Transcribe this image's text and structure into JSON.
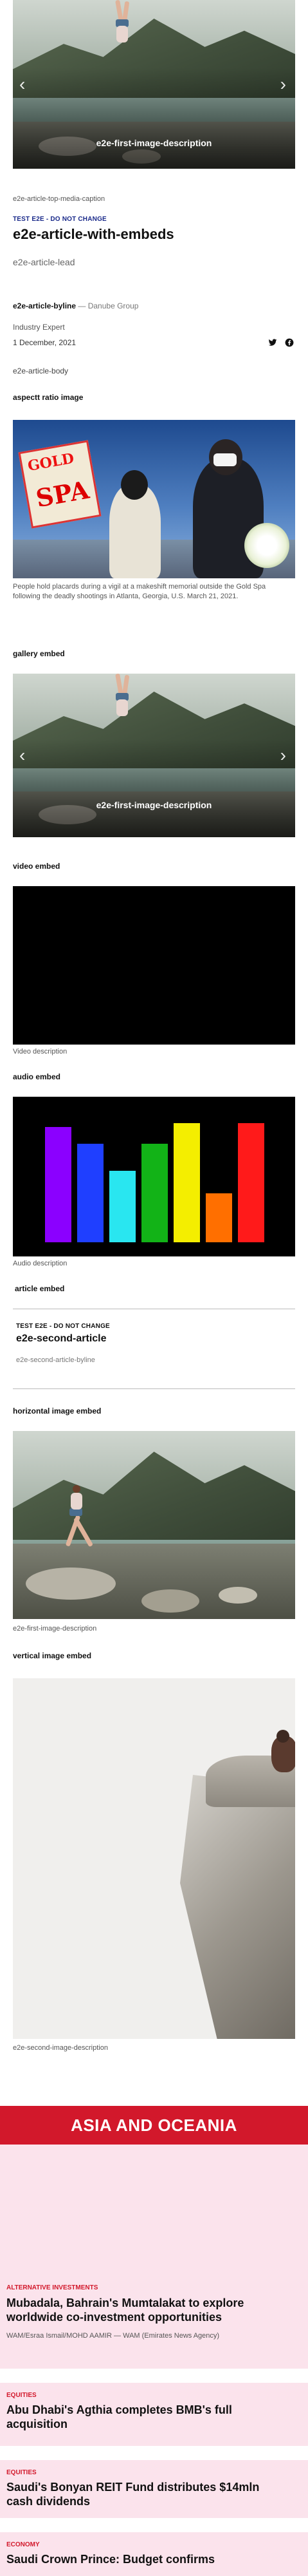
{
  "top_carousel": {
    "overlay_caption": "e2e-first-image-description",
    "media_caption": "e2e-article-top-media-caption"
  },
  "article": {
    "tag": "TEST E2E - DO NOT CHANGE",
    "title": "e2e-article-with-embeds",
    "lead": "e2e-article-lead",
    "byline_name": "e2e-article-byline",
    "byline_sep": " — ",
    "byline_org": "Danube Group",
    "byline_role": "Industry Expert",
    "date": "1 December, 2021",
    "body": "e2e-article-body"
  },
  "social": {
    "twitter_icon": "twitter-icon",
    "facebook_icon": "facebook-icon"
  },
  "sections": {
    "aspect_ratio": "aspectt ratio image",
    "aspect_caption": "People hold placards during a vigil at a makeshift memorial outside the Gold Spa following the deadly shootings in Atlanta, Georgia, U.S. March 21, 2021.",
    "spa_sign_top": "GOLD",
    "spa_sign_bottom": "SPA",
    "gallery": "gallery embed",
    "gallery_overlay": "e2e-first-image-description",
    "video": "video embed",
    "video_caption": "Video description",
    "audio": "audio embed",
    "audio_caption": "Audio description",
    "article_embed": "article embed",
    "embed_tag": "TEST E2E - DO NOT CHANGE",
    "embed_title": "e2e-second-article",
    "embed_byline": "e2e-second-article-byline",
    "horizontal": "horizontal image embed",
    "horizontal_caption": "e2e-first-image-description",
    "vertical": "vertical image embed",
    "vertical_caption": "e2e-second-image-description"
  },
  "audio_bars": {
    "colors": [
      "#8b00ff",
      "#1f3fff",
      "#29e6f0",
      "#12b317",
      "#f4ee00",
      "#ff6f00",
      "#ff1a1a"
    ],
    "levels": [
      0.85,
      0.73,
      0.53,
      0.73,
      0.88,
      0.36,
      0.88
    ]
  },
  "region": {
    "banner": "ASIA AND OCEANIA",
    "stories": [
      {
        "category": "ALTERNATIVE INVESTMENTS",
        "title": "Mubadala, Bahrain's Mumtalakat to explore worldwide co-investment opportunities",
        "meta": "WAM/Esraa Ismail/MOHD AAMIR — WAM (Emirates News Agency)"
      },
      {
        "category": "EQUITIES",
        "title": "Abu Dhabi's Agthia completes BMB's full acquisition"
      },
      {
        "category": "EQUITIES",
        "title": "Saudi's Bonyan REIT Fund distributes $14mln cash dividends"
      },
      {
        "category": "ECONOMY",
        "title": "Saudi Crown Prince: Budget confirms"
      }
    ]
  }
}
